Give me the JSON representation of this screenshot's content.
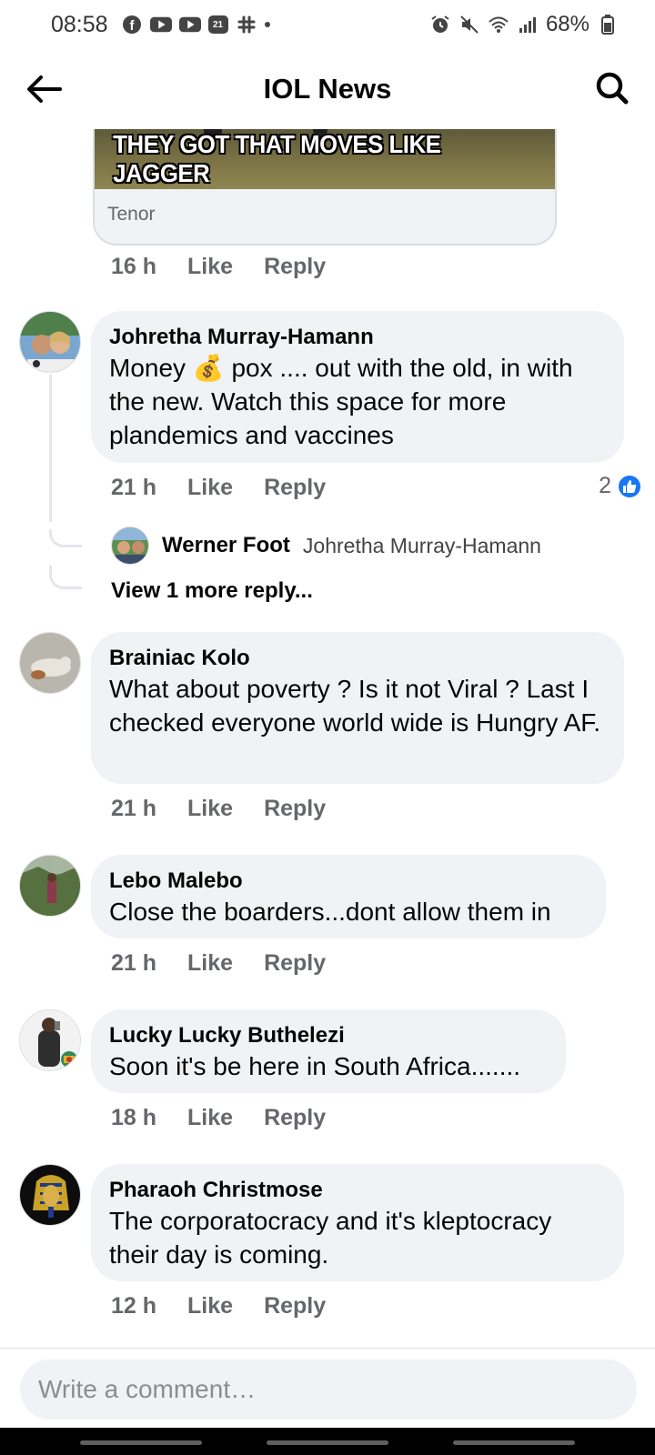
{
  "status_bar": {
    "time": "08:58",
    "calendar_badge": "21",
    "battery": "68%",
    "icons_left": [
      "facebook-icon",
      "youtube-icon",
      "youtube-icon",
      "calendar-icon",
      "slack-icon",
      "dot-icon"
    ],
    "icons_right": [
      "alarm-icon",
      "mute-icon",
      "wifi-icon",
      "signal-icon",
      "battery-icon"
    ]
  },
  "header": {
    "title": "IOL News"
  },
  "gif": {
    "caption": "THEY GOT THAT MOVES LIKE JAGGER",
    "source": "Tenor",
    "time": "16 h",
    "like": "Like",
    "reply": "Reply"
  },
  "comments": [
    {
      "author": "Johretha Murray-Hamann",
      "text_before_emoji": "Money ",
      "emoji": "💰",
      "text_after_emoji": " pox .... out with the old, in with the new. Watch this space for more plandemics and vaccines",
      "time": "21 h",
      "like": "Like",
      "reply": "Reply",
      "reaction_count": "2",
      "avatar_colors": [
        "#6b8fb3",
        "#c9a27a"
      ]
    },
    {
      "author": "Brainiac Kolo",
      "text": "What about poverty ? Is it not Viral ? Last I checked everyone world wide is Hungry AF.",
      "time": "21 h",
      "like": "Like",
      "reply": "Reply",
      "avatar_colors": [
        "#9a9a95",
        "#d8d3c8"
      ]
    },
    {
      "author": "Lebo Malebo",
      "text": "Close the boarders...dont allow them in",
      "time": "21 h",
      "like": "Like",
      "reply": "Reply",
      "avatar_colors": [
        "#4f6b3c",
        "#8d9a7a"
      ]
    },
    {
      "author": "Lucky Lucky Buthelezi",
      "text": "Soon it's be here in South Africa.......",
      "time": "18 h",
      "like": "Like",
      "reply": "Reply",
      "avatar_colors": [
        "#3a3a3a",
        "#e6e6e6"
      ]
    },
    {
      "author": "Pharaoh Christmose",
      "text": "The corporatocracy and it's kleptocracy their day is coming.",
      "time": "12 h",
      "like": "Like",
      "reply": "Reply",
      "avatar_colors": [
        "#111111",
        "#c9a227"
      ]
    }
  ],
  "reply_preview": {
    "author": "Werner Foot",
    "mention": "Johretha Murray-Hamann",
    "view_more": "View 1 more reply..."
  },
  "composer": {
    "placeholder": "Write a comment…"
  }
}
